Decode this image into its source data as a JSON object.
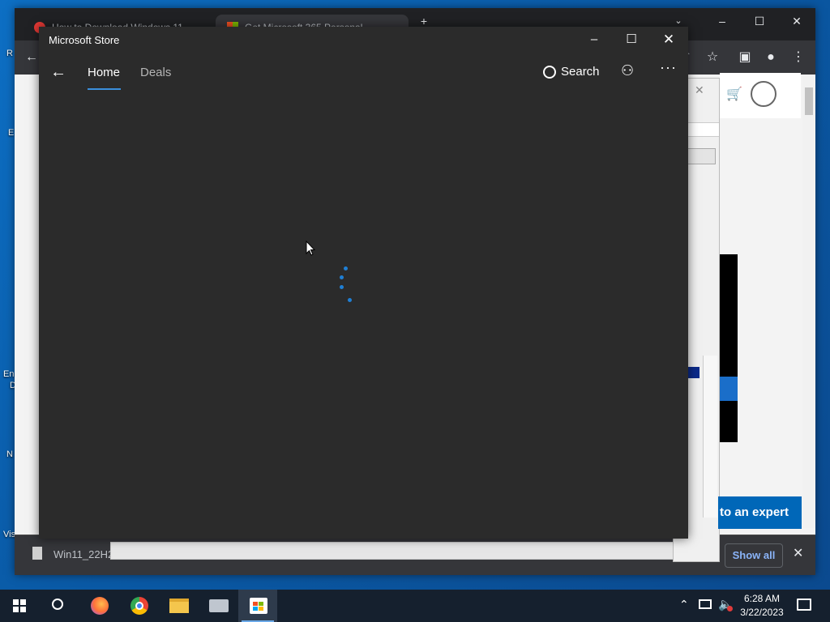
{
  "store": {
    "title": "Microsoft Store",
    "tabs": [
      {
        "label": "Home"
      },
      {
        "label": "Deals"
      }
    ],
    "search_label": "Search"
  },
  "browser": {
    "tabs": [
      {
        "title": "How to Download Windows 11"
      },
      {
        "title": "Get Microsoft 365 Personal"
      }
    ],
    "page": {
      "expert_button": "to an expert"
    },
    "download_bar": {
      "file_name": "Win11_22H2",
      "show_all": "Show all"
    }
  },
  "desktop": {
    "icon_labels": [
      "R",
      "E",
      "En",
      "D",
      "N",
      "Vis"
    ]
  },
  "taskbar": {
    "time": "6:28 AM",
    "date": "3/22/2023"
  },
  "colors": {
    "store_bg": "#2b2b2b",
    "accent": "#3b8fdc",
    "spinner": "#1f7fd4",
    "taskbar": "#15202e",
    "expert_button": "#0067b8"
  }
}
